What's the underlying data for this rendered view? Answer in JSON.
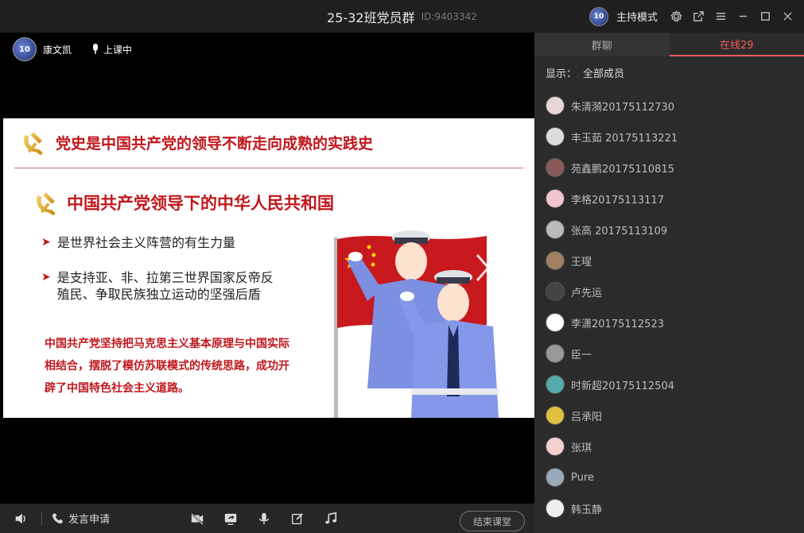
{
  "window": {
    "title": "25-32班党员群",
    "id_label": "ID:9403342",
    "host_mode_label": "主持模式"
  },
  "stage": {
    "presenter_name": "康文凯",
    "class_status": "上课中"
  },
  "slide": {
    "title": "党史是中国共产党的领导不断走向成熟的实践史",
    "subtitle": "中国共产党领导下的中华人民共和国",
    "bullet1": "是世界社会主义阵营的有生力量",
    "bullet2": "是支持亚、非、拉第三世界国家反帝反殖民、争取民族独立运动的坚强后盾",
    "highlight": "中国共产党坚持把马克思主义基本原理与中国实际相结合，摆脱了模仿苏联模式的传统思路，成功开辟了中国特色社会主义道路。"
  },
  "bottombar": {
    "speak_request": "发言申请",
    "end_class": "结束课堂"
  },
  "panel": {
    "tab_chat": "群聊",
    "tab_online": "在线29",
    "filter_label": "显示：",
    "filter_value": "全部成员",
    "members": [
      {
        "name": "朱清漪20175112730",
        "color": "#e8d6d6"
      },
      {
        "name": "丰玉茹 20175113221",
        "color": "#ddd"
      },
      {
        "name": "苑鑫鹏20175110815",
        "color": "#8a5a5a"
      },
      {
        "name": "李格20175113117",
        "color": "#f2c6cc"
      },
      {
        "name": "张高 20175113109",
        "color": "#bbb"
      },
      {
        "name": "王瑆",
        "color": "#a08060"
      },
      {
        "name": "卢先运",
        "color": "#444"
      },
      {
        "name": "李潇20175112523",
        "color": "#fff"
      },
      {
        "name": "臣一",
        "color": "#999"
      },
      {
        "name": "时新超20175112504",
        "color": "#5aa"
      },
      {
        "name": "吕承阳",
        "color": "#e0c040"
      },
      {
        "name": "张琪",
        "color": "#f4d0d0"
      },
      {
        "name": "Pure",
        "color": "#9ab"
      },
      {
        "name": "韩玉静",
        "color": "#eee"
      }
    ]
  }
}
